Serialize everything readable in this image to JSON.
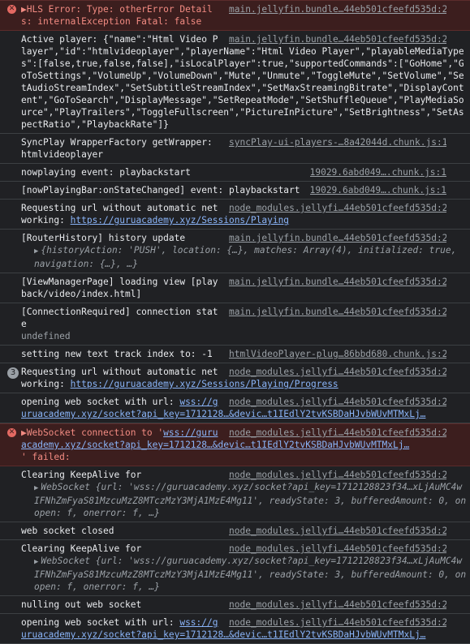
{
  "entries": [
    {
      "id": "e1",
      "type": "error",
      "icon": "error-icon",
      "msg": "▶HLS Error: Type: otherError Details: internalException Fatal: false",
      "src": "main.jellyfin.bundle…44eb501cfeefd535d:2"
    },
    {
      "id": "e2",
      "type": "log",
      "msg": "Active player: {\"name\":\"Html Video Player\",\"id\":\"htmlvideoplayer\",\"playerName\":\"Html Video Player\",\"playableMediaTypes\":[false,true,false,false],\"isLocalPlayer\":true,\"supportedCommands\":[\"GoHome\",\"GoToSettings\",\"VolumeUp\",\"VolumeDown\",\"Mute\",\"Unmute\",\"ToggleMute\",\"SetVolume\",\"SetAudioStreamIndex\",\"SetSubtitleStreamIndex\",\"SetMaxStreamingBitrate\",\"DisplayContent\",\"GoToSearch\",\"DisplayMessage\",\"SetRepeatMode\",\"SetShuffleQueue\",\"PlayMediaSource\",\"PlayTrailers\",\"ToggleFullscreen\",\"PictureInPicture\",\"SetBrightness\",\"SetAspectRatio\",\"PlaybackRate\"]}",
      "src": "main.jellyfin.bundle…44eb501cfeefd535d:2"
    },
    {
      "id": "e3",
      "type": "log",
      "msg": "SyncPlay WrapperFactory getWrapper: htmlvideoplayer",
      "src": "syncPlay-ui-players-…8a42044d.chunk.js:1"
    },
    {
      "id": "e4",
      "type": "log",
      "msg": "nowplaying event: playbackstart",
      "src": "19029.6abd049….chunk.js:1"
    },
    {
      "id": "e5",
      "type": "log",
      "msg": "[nowPlayingBar:onStateChanged] event: playbackstart",
      "src": "19029.6abd049….chunk.js:1"
    },
    {
      "id": "e6",
      "type": "log",
      "msg": "Requesting url without automatic networking: ",
      "link": "https://guruacademy.xyz/Sessions/Playing",
      "src": "node_modules.jellyfi…44eb501cfeefd535d:2"
    },
    {
      "id": "e7",
      "type": "log",
      "msg": "[RouterHistory] history update",
      "src": "main.jellyfin.bundle…44eb501cfeefd535d:2",
      "obj": "{historyAction: 'PUSH', location: {…}, matches: Array(4), initialized: true, navigation: {…}, …}"
    },
    {
      "id": "e8",
      "type": "log",
      "msg": "[ViewManagerPage] loading view [playback/video/index.html]",
      "src": "main.jellyfin.bundle…44eb501cfeefd535d:2"
    },
    {
      "id": "e9",
      "type": "log",
      "msg": "[ConnectionRequired] connection state",
      "gray": "undefined",
      "src": "main.jellyfin.bundle…44eb501cfeefd535d:2"
    },
    {
      "id": "e10",
      "type": "log",
      "msg": "setting new text track index to: -1",
      "src": "htmlVideoPlayer-plug…86bbd680.chunk.js:2"
    },
    {
      "id": "e11",
      "type": "log",
      "count": "3",
      "msg": "Requesting url without automatic networking: ",
      "link": "https://guruacademy.xyz/Sessions/Playing/Progress",
      "src": "node_modules.jellyfi…44eb501cfeefd535d:2"
    },
    {
      "id": "e12",
      "type": "log",
      "msg": "opening web socket with url: ",
      "link": "wss://guruacademy.xyz/socket?api_key=1712128…&devic…t1IEdlY2tvKSBDaHJvbWUvMTMxLj…",
      "src": "node_modules.jellyfi…44eb501cfeefd535d:2"
    },
    {
      "id": "e13",
      "type": "error",
      "icon": "error-icon",
      "msg": "▶WebSocket connection to '",
      "link": "wss://guruacademy.xyz/socket?api_key=1712128…&devic…t1IEdlY2tvKSBDaHJvbWUvMTMxLj…",
      "tail": "' failed:",
      "src": "node_modules.jellyfi…44eb501cfeefd535d:2"
    },
    {
      "id": "e14",
      "type": "log",
      "msg": "Clearing KeepAlive for",
      "src": "node_modules.jellyfi…44eb501cfeefd535d:2",
      "obj": "WebSocket {url: 'wss://guruacademy.xyz/socket?api_key=1712128823f34…xLjAuMC4wIFNhZmFyaS81MzcuMzZ8MTczMzY3MjA1MzE4Mg11', readyState: 3, bufferedAmount: 0, onopen: f, onerror: f, …}"
    },
    {
      "id": "e15",
      "type": "log",
      "msg": "web socket closed",
      "src": "node_modules.jellyfi…44eb501cfeefd535d:2"
    },
    {
      "id": "e16",
      "type": "log",
      "msg": "Clearing KeepAlive for",
      "src": "node_modules.jellyfi…44eb501cfeefd535d:2",
      "obj": "WebSocket {url: 'wss://guruacademy.xyz/socket?api_key=1712128823f34…xLjAuMC4wIFNhZmFyaS81MzcuMzZ8MTczMzY3MjA1MzE4Mg11', readyState: 3, bufferedAmount: 0, onopen: f, onerror: f, …}"
    },
    {
      "id": "e17",
      "type": "log",
      "msg": "nulling out web socket",
      "src": "node_modules.jellyfi…44eb501cfeefd535d:2"
    },
    {
      "id": "e18",
      "type": "log",
      "msg": "opening web socket with url: ",
      "link": "wss://guruacademy.xyz/socket?api_key=1712128…&devic…t1IEdlY2tvKSBDaHJvbWUvMTMxLj…",
      "src": "node_modules.jellyfi…44eb501cfeefd535d:2"
    }
  ]
}
